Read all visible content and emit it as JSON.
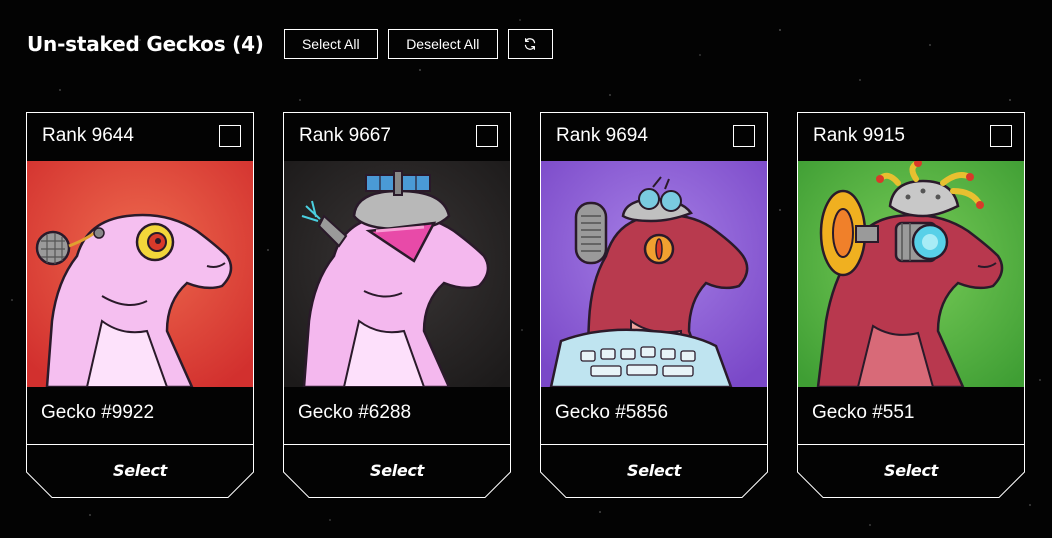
{
  "header": {
    "title": "Un-staked Geckos (4)",
    "select_all_label": "Select All",
    "deselect_all_label": "Deselect All",
    "refresh_icon": "refresh-icon"
  },
  "cards": [
    {
      "rank": "Rank 9644",
      "name": "Gecko #9922",
      "select_label": "Select",
      "checked": false,
      "background": "#e0403a",
      "skin": "#f4b8ea",
      "traits": [
        "mesh-radar-earpiece",
        "yellow-eye-lens"
      ]
    },
    {
      "rank": "Rank 9667",
      "name": "Gecko #6288",
      "select_label": "Select",
      "checked": false,
      "background": "#2a2828",
      "skin": "#f2b4ec",
      "traits": [
        "satellite-helmet",
        "pink-visor",
        "antenna-gun"
      ]
    },
    {
      "rank": "Rank 9694",
      "name": "Gecko #5856",
      "select_label": "Select",
      "checked": false,
      "background": "#8f5fd6",
      "skin": "#b83a4e",
      "traits": [
        "goggles-helmet",
        "grille-earpiece",
        "orange-eye-lens",
        "keyboard-vest"
      ]
    },
    {
      "rank": "Rank 9915",
      "name": "Gecko #551",
      "select_label": "Select",
      "checked": false,
      "background": "#4caf3c",
      "skin": "#b8384e",
      "traits": [
        "tentacle-dome-helmet",
        "yellow-ear-ring",
        "cyan-camera-eye"
      ]
    }
  ]
}
